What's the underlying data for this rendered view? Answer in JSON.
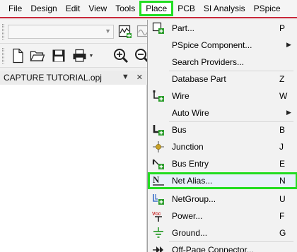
{
  "menubar": {
    "items": [
      {
        "label": "File"
      },
      {
        "label": "Design"
      },
      {
        "label": "Edit"
      },
      {
        "label": "View"
      },
      {
        "label": "Tools"
      },
      {
        "label": "Place",
        "active": true
      },
      {
        "label": "PCB"
      },
      {
        "label": "SI Analysis"
      },
      {
        "label": "PSpice"
      }
    ]
  },
  "toolbar": {
    "combo_value": "",
    "icons": [
      "add-part-icon",
      "pspice-icon",
      "new-file-icon",
      "open-folder-icon",
      "save-icon",
      "print-icon",
      "zoom-in-icon",
      "zoom-out-icon"
    ]
  },
  "project_pane": {
    "title": "CAPTURE TUTORIAL.opj",
    "pin_glyph": "▼",
    "close_glyph": "✕"
  },
  "place_menu": {
    "items": [
      {
        "label": "Part...",
        "shortcut": "P",
        "icon": "part-icon"
      },
      {
        "label": "PSpice Component...",
        "submenu": true
      },
      {
        "label": "Search Providers..."
      },
      {
        "label": "Database Part",
        "shortcut": "Z"
      },
      {
        "label": "Wire",
        "shortcut": "W",
        "icon": "wire-icon"
      },
      {
        "label": "Auto Wire",
        "submenu": true
      },
      {
        "label": "Bus",
        "shortcut": "B",
        "icon": "bus-icon"
      },
      {
        "label": "Junction",
        "shortcut": "J",
        "icon": "junction-icon"
      },
      {
        "label": "Bus Entry",
        "shortcut": "E",
        "icon": "bus-entry-icon"
      },
      {
        "label": "Net Alias...",
        "shortcut": "N",
        "icon": "net-alias-icon",
        "highlighted": true
      },
      {
        "label": "NetGroup...",
        "shortcut": "U",
        "icon": "netgroup-icon"
      },
      {
        "label": "Power...",
        "shortcut": "F",
        "icon": "power-icon"
      },
      {
        "label": "Ground...",
        "shortcut": "G",
        "icon": "ground-icon"
      },
      {
        "label": "Off-Page Connector...",
        "icon": "off-page-connector-icon"
      }
    ],
    "submenu_glyph": "▶"
  },
  "colors": {
    "highlight_border": "#22dd22",
    "menubar_underline": "#c8283a",
    "icon_green": "#2e9e2e"
  }
}
